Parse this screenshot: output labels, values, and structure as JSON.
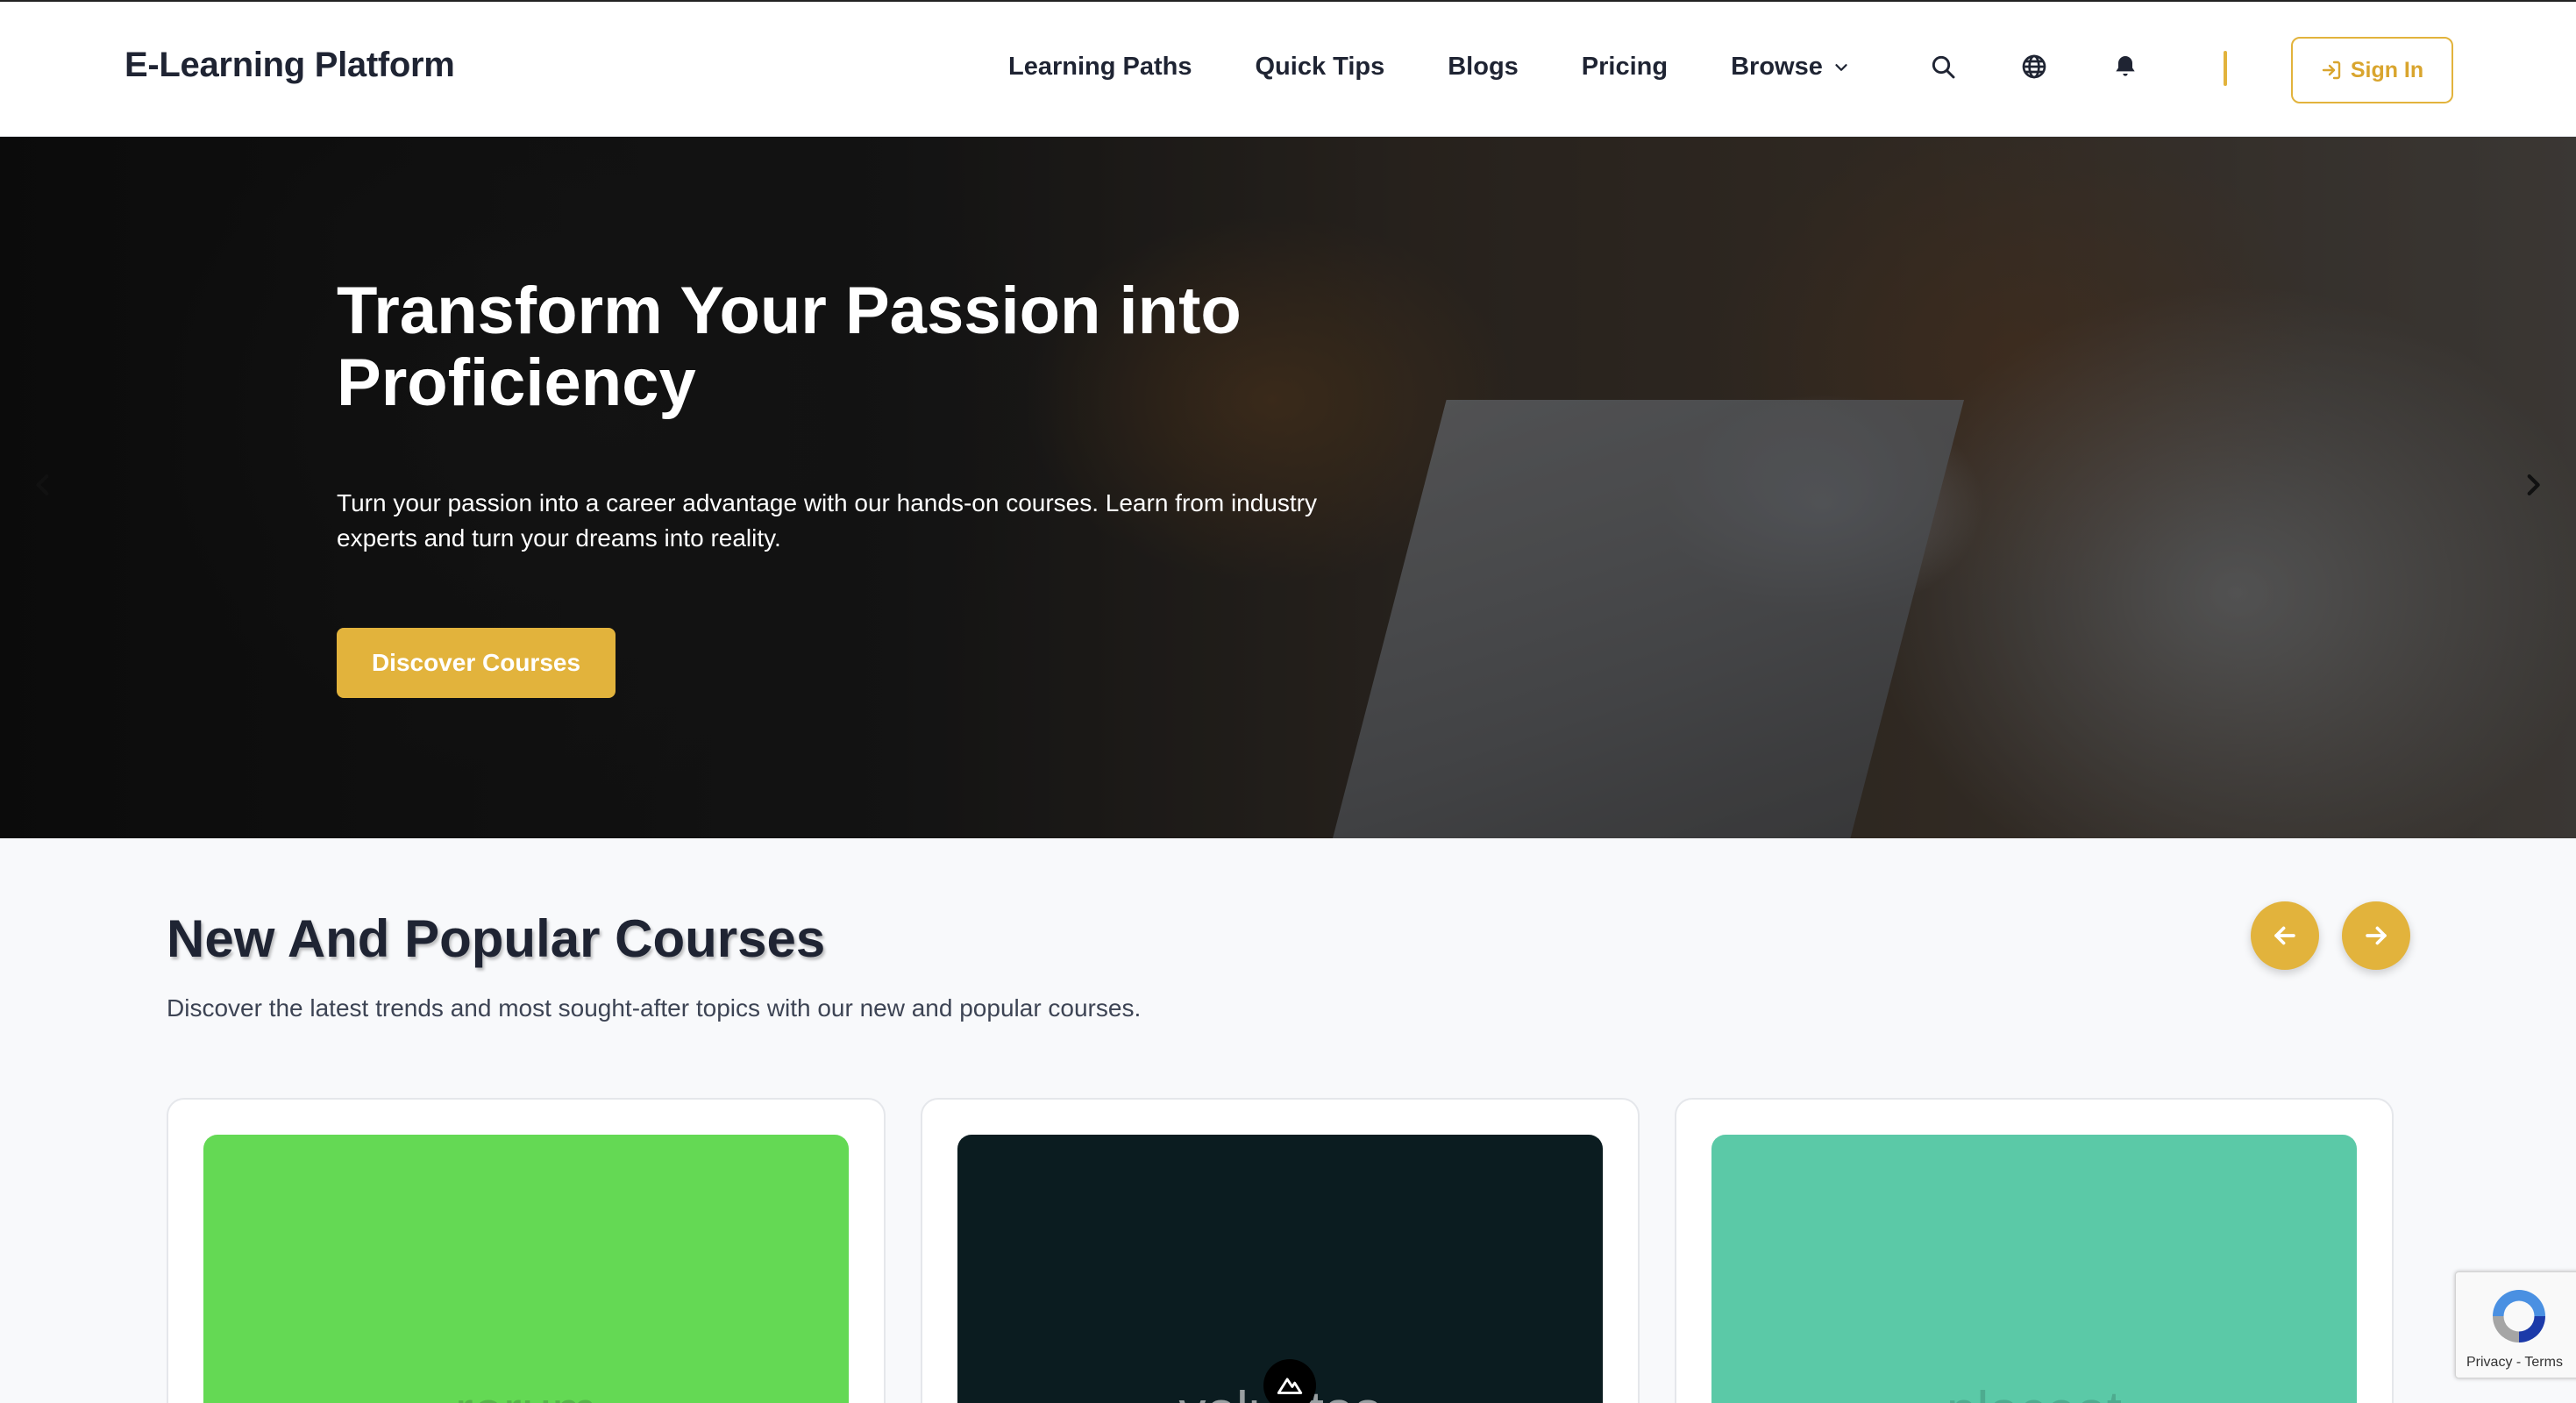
{
  "header": {
    "brand": "E-Learning Platform",
    "nav": [
      {
        "label": "Learning Paths"
      },
      {
        "label": "Quick Tips"
      },
      {
        "label": "Blogs"
      },
      {
        "label": "Pricing"
      },
      {
        "label": "Browse"
      }
    ],
    "icons": [
      "search-icon",
      "globe-icon",
      "bell-icon"
    ],
    "sign_in": "Sign In",
    "accent_color": "#e2b33c"
  },
  "hero": {
    "title": "Transform Your Passion into Proficiency",
    "subtitle": "Turn your passion into a career advantage with our hands-on courses. Learn from industry experts and turn your dreams into reality.",
    "cta": "Discover Courses"
  },
  "courses": {
    "title": "New And Popular Courses",
    "subtitle": "Discover the latest trends and most sought-after topics with our new and popular courses.",
    "cards": [
      {
        "label": "rerum",
        "bg": "#64d954",
        "text_color": "#55b34a"
      },
      {
        "label": "voluptas",
        "bg": "#0b1c20",
        "text_color": "#9aa0a2"
      },
      {
        "label": "placeat",
        "bg": "#5bc9a7",
        "text_color": "#4eab8f"
      }
    ]
  },
  "recaptcha": {
    "privacy": "Privacy",
    "separator": " - ",
    "terms": "Terms"
  }
}
